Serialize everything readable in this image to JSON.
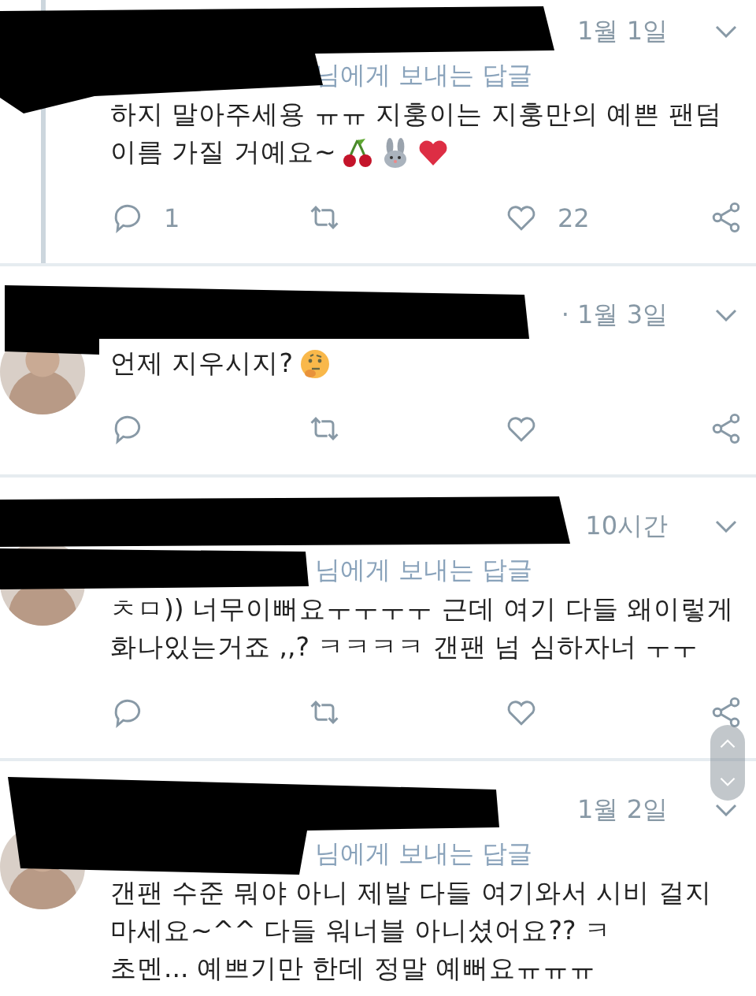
{
  "tweets": [
    {
      "time": "1월 1일",
      "reply_to": "님에게 보내는 답글",
      "lines": [
        "하지 말아주세용 ㅠㅠ 지훙이는 지훙만의 예쁜 팬덤",
        "이름 가질 거예요~"
      ],
      "emojis": [
        {
          "kind": "cherries"
        },
        {
          "kind": "rabbit"
        },
        {
          "kind": "heart"
        }
      ],
      "replies": "1",
      "likes": "22",
      "thread": true,
      "avatar": false
    },
    {
      "time": "· 1월 3일",
      "lines": [
        "언제 지우시지?"
      ],
      "emojis": [
        {
          "kind": "thinking"
        }
      ],
      "thread": false,
      "avatar": true
    },
    {
      "time": "10시간",
      "reply_to": "님에게 보내는 답글",
      "lines": [
        "ㅊㅁ)) 너무이뻐요ㅜㅜㅜㅜ 근데 여기 다들 왜이렇게",
        "화나있는거죠 ,,? ㅋㅋㅋㅋ 갠팬 넘 심하자너 ㅜㅜ"
      ],
      "thread": false,
      "avatar": true
    },
    {
      "time": "1월 2일",
      "reply_to": "님에게 보내는 답글",
      "lines": [
        "갠팬 수준 뭐야 아니 제발 다들 여기와서 시비 걸지",
        "마세요~^^ 다들 워너블 아니셨어요?? ㅋ",
        "초멘... 예쁘기만 한데 정말 예뻐요ㅠㅠㅠ"
      ],
      "thread": false,
      "avatar": true
    }
  ]
}
